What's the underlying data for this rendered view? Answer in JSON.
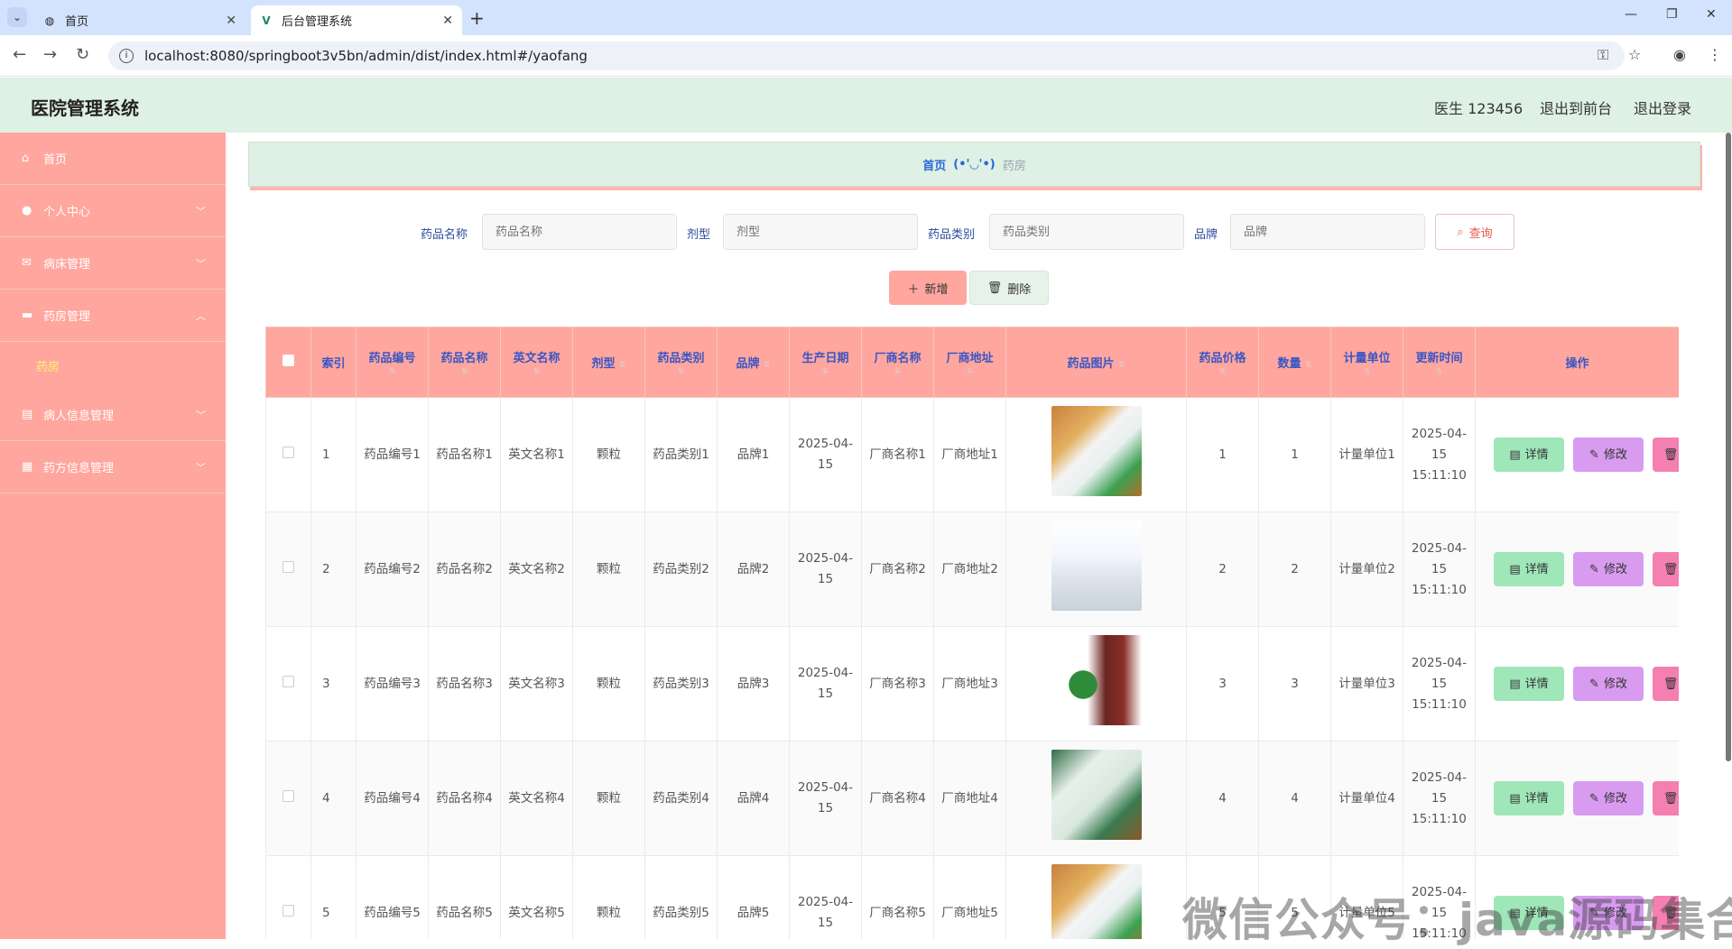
{
  "browser": {
    "tabs": [
      {
        "title": "首页"
      },
      {
        "title": "后台管理系统"
      }
    ],
    "url": "localhost:8080/springboot3v5bn/admin/dist/index.html#/yaofang"
  },
  "header": {
    "title": "医院管理系统",
    "user": "医生 123456",
    "to_front": "退出到前台",
    "logout": "退出登录"
  },
  "sidebar": {
    "items": [
      {
        "label": "首页",
        "icon": "home-icon"
      },
      {
        "label": "个人中心",
        "icon": "user-icon"
      },
      {
        "label": "病床管理",
        "icon": "mail-icon"
      },
      {
        "label": "药房管理",
        "icon": "briefcase-icon"
      },
      {
        "label": "病人信息管理",
        "icon": "document-icon"
      },
      {
        "label": "药方信息管理",
        "icon": "grid-icon"
      }
    ],
    "submenu": {
      "label": "药房"
    }
  },
  "breadcrumb": {
    "home": "首页",
    "separator": "(•'◡'•)",
    "current": "药房"
  },
  "search": {
    "fields": [
      {
        "label": "药品名称",
        "placeholder": "药品名称"
      },
      {
        "label": "剂型",
        "placeholder": "剂型"
      },
      {
        "label": "药品类别",
        "placeholder": "药品类别"
      },
      {
        "label": "品牌",
        "placeholder": "品牌"
      }
    ],
    "query_label": "查询"
  },
  "actions": {
    "add_label": "新增",
    "delete_label": "删除"
  },
  "table": {
    "columns": [
      "索引",
      "药品编号",
      "药品名称",
      "英文名称",
      "剂型",
      "药品类别",
      "品牌",
      "生产日期",
      "厂商名称",
      "厂商地址",
      "药品图片",
      "药品价格",
      "数量",
      "计量单位",
      "更新时间",
      "操作"
    ],
    "op_labels": {
      "detail": "详情",
      "edit": "修改"
    },
    "rows": [
      {
        "index": "1",
        "code": "药品编号1",
        "name": "药品名称1",
        "en": "英文名称1",
        "form": "颗粒",
        "cat": "药品类别1",
        "brand": "品牌1",
        "date": "2025-04-15",
        "maker": "厂商名称1",
        "addr": "厂商地址1",
        "img": "medicine-bottles",
        "price": "1",
        "qty": "1",
        "unit": "计量单位1",
        "updated": "2025-04-15 15:11:10"
      },
      {
        "index": "2",
        "code": "药品编号2",
        "name": "药品名称2",
        "en": "英文名称2",
        "form": "颗粒",
        "cat": "药品类别2",
        "brand": "品牌2",
        "date": "2025-04-15",
        "maker": "厂商名称2",
        "addr": "厂商地址2",
        "img": "tablet-blister",
        "price": "2",
        "qty": "2",
        "unit": "计量单位2",
        "updated": "2025-04-15 15:11:10"
      },
      {
        "index": "3",
        "code": "药品编号3",
        "name": "药品名称3",
        "en": "英文名称3",
        "form": "颗粒",
        "cat": "药品类别3",
        "brand": "品牌3",
        "date": "2025-04-15",
        "maker": "厂商名称3",
        "addr": "厂商地址3",
        "img": "syrup-bottle",
        "price": "3",
        "qty": "3",
        "unit": "计量单位3",
        "updated": "2025-04-15 15:11:10"
      },
      {
        "index": "4",
        "code": "药品编号4",
        "name": "药品名称4",
        "en": "英文名称4",
        "form": "颗粒",
        "cat": "药品类别4",
        "brand": "品牌4",
        "date": "2025-04-15",
        "maker": "厂商名称4",
        "addr": "厂商地址4",
        "img": "medicine-box",
        "price": "4",
        "qty": "4",
        "unit": "计量单位4",
        "updated": "2025-04-15 15:11:10"
      },
      {
        "index": "5",
        "code": "药品编号5",
        "name": "药品名称5",
        "en": "英文名称5",
        "form": "颗粒",
        "cat": "药品类别5",
        "brand": "品牌5",
        "date": "2025-04-15",
        "maker": "厂商名称5",
        "addr": "厂商地址5",
        "img": "medicine-bottles",
        "price": "5",
        "qty": "5",
        "unit": "计量单位5",
        "updated": "2025-04-15 15:11:10"
      }
    ]
  },
  "watermark": "微信公众号：java源码集合",
  "colors": {
    "header_bg": "#dff0e4",
    "sidebar_bg": "#ffa69e",
    "table_header_bg": "#ffa69e",
    "header_text": "#3a56c4",
    "detail_btn": "#9fe6b8",
    "edit_btn": "#d89bf0",
    "delete_btn": "#f47fb0"
  }
}
